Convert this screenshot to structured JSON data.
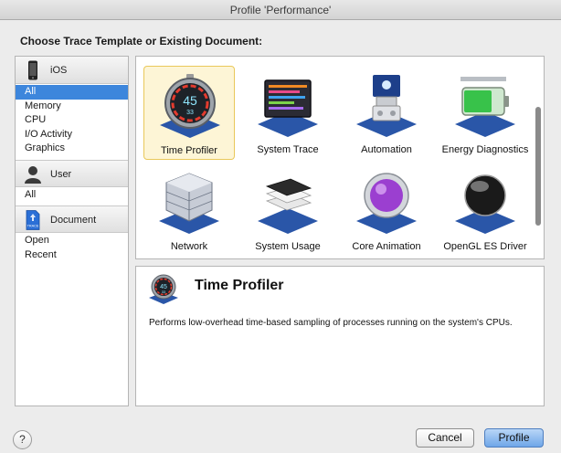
{
  "window": {
    "title": "Profile 'Performance'"
  },
  "heading": "Choose Trace Template or Existing Document:",
  "sidebar": {
    "groups": [
      {
        "title": "iOS",
        "icon": "iphone-icon",
        "items": [
          "All",
          "Memory",
          "CPU",
          "I/O Activity",
          "Graphics"
        ],
        "selected_index": 0
      },
      {
        "title": "User",
        "icon": "user-silhouette-icon",
        "items": [
          "All"
        ]
      },
      {
        "title": "Document",
        "icon": "trace-document-icon",
        "icon_text": "TRACE",
        "items": [
          "Open",
          "Recent"
        ]
      }
    ]
  },
  "templates": [
    {
      "label": "Time Profiler",
      "icon": "stopwatch-icon",
      "selected": true,
      "icon_text_top": "45",
      "icon_text_bottom": "33"
    },
    {
      "label": "System Trace",
      "icon": "system-trace-icon"
    },
    {
      "label": "Automation",
      "icon": "automation-robot-icon"
    },
    {
      "label": "Energy Diagnostics",
      "icon": "battery-icon"
    },
    {
      "label": "Network",
      "icon": "network-cube-icon"
    },
    {
      "label": "System Usage",
      "icon": "system-usage-devices-icon"
    },
    {
      "label": "Core Animation",
      "icon": "core-animation-sphere-icon"
    },
    {
      "label": "OpenGL ES Driver",
      "icon": "opengl-sphere-icon"
    }
  ],
  "detail": {
    "title": "Time Profiler",
    "icon": "stopwatch-icon",
    "icon_text_top": "45",
    "icon_text_bottom": "33",
    "description": "Performs low-overhead time-based sampling of processes running on the system's CPUs."
  },
  "buttons": {
    "help": "?",
    "cancel": "Cancel",
    "profile": "Profile"
  },
  "colors": {
    "selection": "#3d86dc",
    "tile_selection": "#fdf5d6",
    "default_button": "#6fa6e8"
  }
}
